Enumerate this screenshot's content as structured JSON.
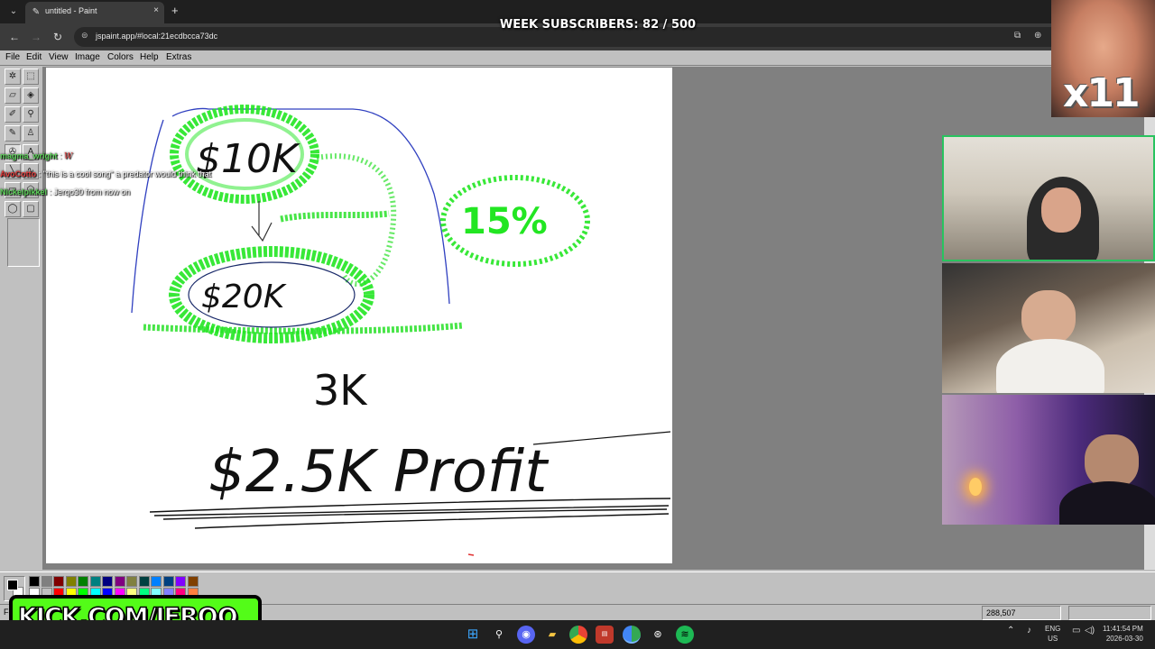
{
  "browser": {
    "tab_title": "untitled - Paint",
    "tab_close": "×",
    "new_tab": "+",
    "url": "jspaint.app/#local:21ecdbcca73dc"
  },
  "paint": {
    "menu": [
      "File",
      "Edit",
      "View",
      "Image",
      "Colors",
      "Help",
      "Extras"
    ],
    "status_text": "Fo",
    "coords": "288,507",
    "palette_colors": [
      "#000000",
      "#808080",
      "#800000",
      "#808000",
      "#008000",
      "#008080",
      "#000080",
      "#800080",
      "#808040",
      "#004040",
      "#0080ff",
      "#004080",
      "#8000ff",
      "#804000",
      "#ffffff",
      "#c0c0c0",
      "#ff0000",
      "#ffff00",
      "#00ff00",
      "#00ffff",
      "#0000ff",
      "#ff00ff",
      "#ffff80",
      "#00ff80",
      "#80ffff",
      "#8080ff",
      "#ff0080",
      "#ff8040"
    ],
    "canvas_text": {
      "top_bubble": "$10K",
      "middle_bubble": "$20K",
      "percent": "15%",
      "cost": "3K",
      "profit": "$2.5K Profit"
    }
  },
  "overlay": {
    "subscribers": "WEEK SUBSCRIBERS: 82 / 500",
    "multiplier": "x11",
    "kick": "KICK.COM/JERQO",
    "chat": [
      {
        "name": "magma_wright",
        "message": "W",
        "color": "#5dd35a"
      },
      {
        "name": "AvoCotto",
        "message": "\"this is a cool song\" a predator would think that",
        "color": "#e03d3d"
      },
      {
        "name": "Nickelpikkel",
        "message": "Jerqo30 from now on",
        "color": "#5dd35a"
      }
    ]
  },
  "taskbar": {
    "lang_top": "ENG",
    "lang_bottom": "US",
    "time": "11:41:54 PM",
    "date": "2026-03-30"
  }
}
